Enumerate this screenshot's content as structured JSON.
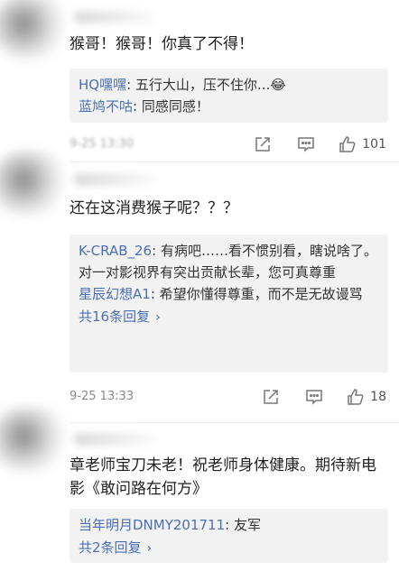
{
  "comments": [
    {
      "text": "猴哥！猴哥！你真了不得！",
      "replies": [
        {
          "name": "HQ嘿嘿",
          "sep": ": ",
          "text": "五行大山，压不住你...😂"
        },
        {
          "name": "蓝鸠不咕",
          "sep": ": ",
          "text": "同感同感！"
        }
      ],
      "timestamp": "9-25 13:30",
      "likes": "101"
    },
    {
      "text": "还在这消费猴子呢？？？",
      "replies": [
        {
          "name": "K-CRAB_26",
          "sep": ": ",
          "text": "有病吧……看不惯别看，瞎说啥了。对一对影视界有突出贡献长辈，您可真尊重"
        },
        {
          "name": "星辰幻想A1",
          "sep": ": ",
          "text": "希望你懂得尊重，而不是无故谩骂"
        }
      ],
      "more_label": "共16条回复",
      "timestamp": "9-25 13:33",
      "likes": "18"
    },
    {
      "text": "章老师宝刀未老！祝老师身体健康。期待新电影《敢问路在何方》",
      "replies": [
        {
          "name": "当年明月DNMY201711",
          "sep": ": ",
          "text": "友军"
        }
      ],
      "more_label": "共2条回复"
    }
  ],
  "icons": {
    "share": "share-icon",
    "comment": "comment-icon",
    "like": "thumbs-up-icon",
    "more_arrow": "chevron-right-icon"
  },
  "colors": {
    "link": "#4a6fb5",
    "reply_bg": "#f2f2f2",
    "meta": "#8a8a8a"
  }
}
